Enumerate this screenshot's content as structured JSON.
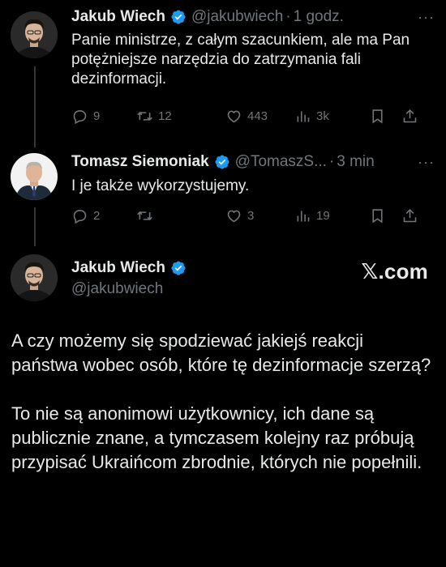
{
  "tweet1": {
    "name": "Jakub Wiech",
    "handle": "@jakubwiech",
    "separator": "·",
    "time": "1 godz.",
    "more": "···",
    "text": "Panie ministrze, z całym szacunkiem, ale ma Pan potężniejsze narzędzia do zatrzymania fali dezinformacji.",
    "replies": "9",
    "retweets": "12",
    "likes": "443",
    "views": "3k"
  },
  "tweet2": {
    "name": "Tomasz Siemoniak",
    "handle": "@TomaszS...",
    "separator": "·",
    "time": "3 min",
    "more": "···",
    "text": "I je także wykorzystujemy.",
    "replies": "2",
    "retweets": "",
    "likes": "3",
    "views": "19"
  },
  "tweet3": {
    "name": "Jakub Wiech",
    "handle": "@jakubwiech",
    "watermark": "𝕏.com",
    "paragraph1": "A czy możemy się spodziewać jakiejś reakcji państwa wobec osób, które tę dezinformacje szerzą?",
    "paragraph2": "To nie są anonimowi użytkownicy, ich dane są publicznie znane, a tymczasem kolejny raz próbują przypisać Ukraińcom zbrodnie, których nie popełnili."
  },
  "colors": {
    "background": "#000000",
    "text": "#e7e9ea",
    "muted": "#71767b",
    "verified": "#1d9bf0"
  },
  "icons": [
    "reply-icon",
    "retweet-icon",
    "like-icon",
    "views-icon",
    "bookmark-icon",
    "share-icon",
    "verified-icon",
    "more-icon"
  ]
}
